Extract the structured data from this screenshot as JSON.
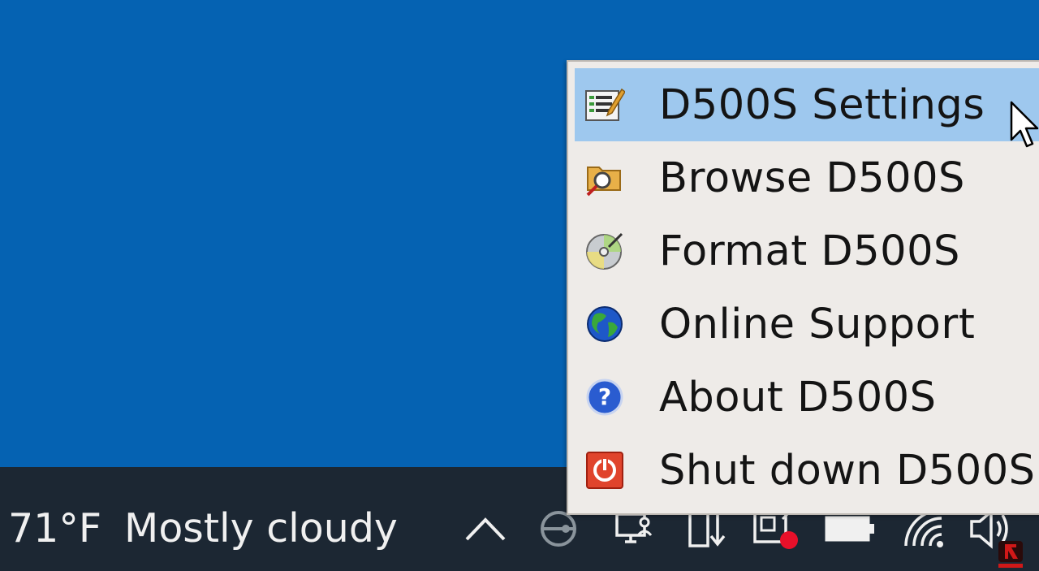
{
  "taskbar": {
    "weather": {
      "temperature": "71°F",
      "condition": "Mostly cloudy"
    },
    "tray_icons": [
      "chevron-up-icon",
      "usb-drive-icon",
      "meet-now-icon",
      "safely-remove-icon",
      "notification-icon",
      "battery-icon",
      "wifi-icon",
      "volume-icon"
    ]
  },
  "context_menu": {
    "items": [
      {
        "label": "D500S Settings",
        "icon": "settings-icon",
        "highlighted": true
      },
      {
        "label": "Browse D500S",
        "icon": "browse-folder-icon",
        "highlighted": false
      },
      {
        "label": "Format D500S",
        "icon": "format-disc-icon",
        "highlighted": false
      },
      {
        "label": "Online Support",
        "icon": "globe-icon",
        "highlighted": false
      },
      {
        "label": "About D500S",
        "icon": "help-icon",
        "highlighted": false
      },
      {
        "label": "Shut down D500S",
        "icon": "power-icon",
        "highlighted": false
      }
    ]
  },
  "colors": {
    "desktop": "#0562b2",
    "taskbar": "#1c2733",
    "menu_background": "#eeebe8",
    "menu_highlight": "#9ec8ee",
    "notification_dot": "#e8102a"
  }
}
